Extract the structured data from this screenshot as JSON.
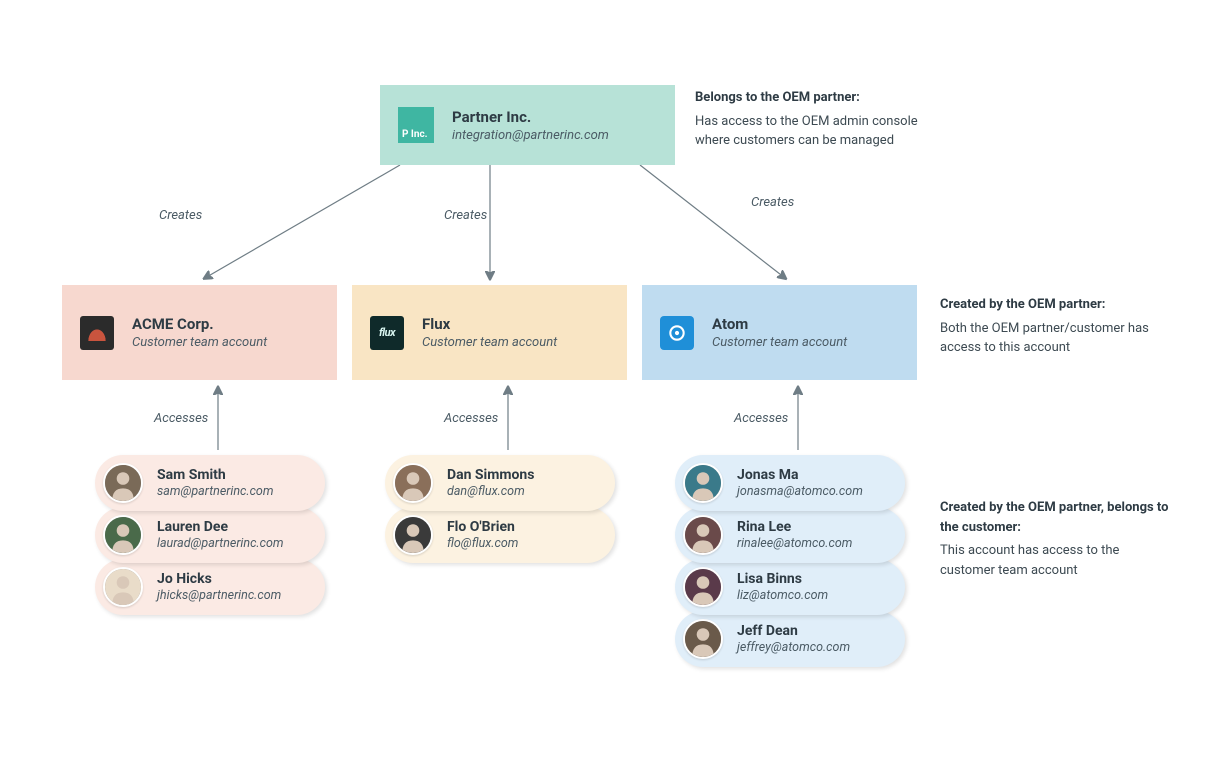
{
  "partner": {
    "name": "Partner Inc.",
    "email": "integration@partnerinc.com",
    "logo_text": "P Inc."
  },
  "customers": [
    {
      "id": "acme",
      "name": "ACME Corp.",
      "subtitle": "Customer team account",
      "logo": "acme"
    },
    {
      "id": "flux",
      "name": "Flux",
      "subtitle": "Customer team account",
      "logo": "flux",
      "logo_text": "flux"
    },
    {
      "id": "atom",
      "name": "Atom",
      "subtitle": "Customer team account",
      "logo": "atom"
    }
  ],
  "users": {
    "acme": [
      {
        "name": "Sam Smith",
        "email": "sam@partnerinc.com",
        "avatar_bg": "#7a6a58"
      },
      {
        "name": "Lauren Dee",
        "email": "laurad@partnerinc.com",
        "avatar_bg": "#4a6a4a"
      },
      {
        "name": "Jo Hicks",
        "email": "jhicks@partnerinc.com",
        "avatar_bg": "#e9dcc9"
      }
    ],
    "flux": [
      {
        "name": "Dan Simmons",
        "email": "dan@flux.com",
        "avatar_bg": "#8a6f5a"
      },
      {
        "name": "Flo O'Brien",
        "email": "flo@flux.com",
        "avatar_bg": "#3a3a3a"
      }
    ],
    "atom": [
      {
        "name": "Jonas Ma",
        "email": "jonasma@atomco.com",
        "avatar_bg": "#3a7a8a"
      },
      {
        "name": "Rina Lee",
        "email": "rinalee@atomco.com",
        "avatar_bg": "#6a4a4a"
      },
      {
        "name": "Lisa Binns",
        "email": "liz@atomco.com",
        "avatar_bg": "#5a3a4a"
      },
      {
        "name": "Jeff Dean",
        "email": "jeffrey@atomco.com",
        "avatar_bg": "#6a5a4a"
      }
    ]
  },
  "edges": {
    "creates": "Creates",
    "accesses": "Accesses"
  },
  "notes": {
    "partner": {
      "title": "Belongs to the OEM partner:",
      "body": "Has access to the OEM admin console where customers can be managed"
    },
    "customer": {
      "title": "Created by the OEM partner:",
      "body": "Both the OEM partner/customer has access to this account"
    },
    "user": {
      "title": "Created by the OEM partner, belongs to the customer:",
      "body": "This account has access to the customer team account"
    }
  }
}
